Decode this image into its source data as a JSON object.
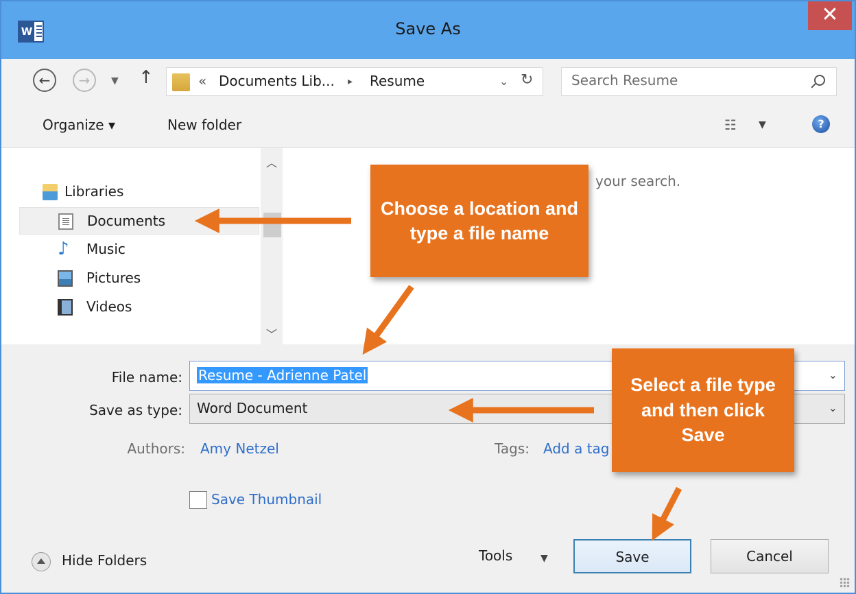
{
  "window": {
    "title": "Save As",
    "app_icon_letter": "W",
    "close_glyph": "✕"
  },
  "address_bar": {
    "back_glyph": "←",
    "forward_glyph": "→",
    "up_glyph": "↑",
    "breadcrumb_overflow": "«",
    "breadcrumb": [
      "Documents Lib...",
      "Resume"
    ],
    "breadcrumb_separator": "▸",
    "dropdown_glyph": "⌄",
    "refresh_glyph": "↻",
    "search_placeholder": "Search Resume"
  },
  "toolbar": {
    "organize_label": "Organize ▾",
    "new_folder_label": "New folder",
    "help_glyph": "?"
  },
  "nav_pane": {
    "items": [
      {
        "label": "Libraries",
        "icon": "libraries-icon",
        "selected": false
      },
      {
        "label": "Documents",
        "icon": "documents-icon",
        "selected": true
      },
      {
        "label": "Music",
        "icon": "music-icon",
        "selected": false
      },
      {
        "label": "Pictures",
        "icon": "pictures-icon",
        "selected": false
      },
      {
        "label": "Videos",
        "icon": "videos-icon",
        "selected": false
      }
    ]
  },
  "content": {
    "empty_message": "your search."
  },
  "form": {
    "file_name_label": "File name:",
    "file_name_value": "Resume - Adrienne Patel",
    "save_as_type_label": "Save as type:",
    "save_as_type_value": "Word Document",
    "authors_label": "Authors:",
    "authors_value": "Amy Netzel",
    "tags_label": "Tags:",
    "tags_value": "Add a tag",
    "save_thumbnail_label": "Save Thumbnail"
  },
  "footer": {
    "hide_folders_label": "Hide Folders",
    "tools_label": "Tools",
    "save_label": "Save",
    "cancel_label": "Cancel"
  },
  "callouts": {
    "top": "Choose a location and type a file name",
    "right": "Select a file type and then click Save"
  },
  "colors": {
    "titlebar": "#5aa6ec",
    "close_button": "#c75050",
    "callout": "#e8731e",
    "link": "#2f6ec9",
    "selection": "#3399ff"
  }
}
